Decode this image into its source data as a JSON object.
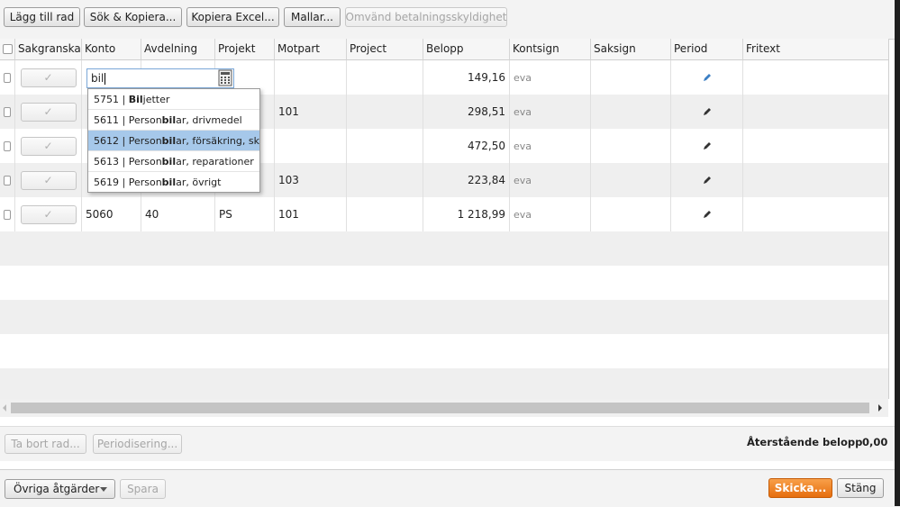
{
  "toolbar_top": {
    "buttons": [
      {
        "label": "Lägg till rad",
        "enabled": true
      },
      {
        "label": "Sök & Kopiera...",
        "enabled": true
      },
      {
        "label": "Kopiera Excel...",
        "enabled": true
      },
      {
        "label": "Mallar...",
        "enabled": true
      },
      {
        "label": "Omvänd betalningsskyldighet",
        "enabled": false
      }
    ]
  },
  "grid": {
    "columns": [
      "",
      "Sakgranska",
      "Konto",
      "Avdelning",
      "Projekt",
      "Motpart",
      "Project",
      "Belopp",
      "Kontsign",
      "Saksign",
      "Period",
      "Fritext"
    ],
    "rows": [
      {
        "konto": "",
        "avdelning": "",
        "projekt": "",
        "motpart": "",
        "project": "",
        "belopp": "149,16",
        "kontsign": "eva",
        "saksign": "",
        "period_icon": "pencil-icon",
        "fritext": ""
      },
      {
        "konto": "",
        "avdelning": "",
        "projekt": "",
        "motpart": "101",
        "project": "",
        "belopp": "298,51",
        "kontsign": "eva",
        "saksign": "",
        "period_icon": "pencil-icon",
        "fritext": ""
      },
      {
        "konto": "",
        "avdelning": "",
        "projekt": "",
        "motpart": "",
        "project": "",
        "belopp": "472,50",
        "kontsign": "eva",
        "saksign": "",
        "period_icon": "pencil-icon",
        "fritext": ""
      },
      {
        "konto": "",
        "avdelning": "",
        "projekt": "",
        "motpart": "103",
        "project": "",
        "belopp": "223,84",
        "kontsign": "eva",
        "saksign": "",
        "period_icon": "pencil-icon",
        "fritext": ""
      },
      {
        "konto": "5060",
        "avdelning": "40",
        "projekt": "PS",
        "motpart": "101",
        "project": "",
        "belopp": "1 218,99",
        "kontsign": "eva",
        "saksign": "",
        "period_icon": "pencil-icon",
        "fritext": ""
      }
    ],
    "sakgranska_mark": "✓"
  },
  "konto_editor": {
    "value": "bil",
    "suggestions": [
      {
        "code": "5751",
        "sep": " | ",
        "pre": "",
        "match": "Bil",
        "post": "jetter",
        "selected": false
      },
      {
        "code": "5611",
        "sep": " | ",
        "pre": "Person",
        "match": "bil",
        "post": "ar, drivmedel",
        "selected": false
      },
      {
        "code": "5612",
        "sep": " | ",
        "pre": "Person",
        "match": "bil",
        "post": "ar, försäkring, skatt",
        "selected": true
      },
      {
        "code": "5613",
        "sep": " | ",
        "pre": "Person",
        "match": "bil",
        "post": "ar, reparationer",
        "selected": false
      },
      {
        "code": "5619",
        "sep": " | ",
        "pre": "Person",
        "match": "bil",
        "post": "ar, övrigt",
        "selected": false
      }
    ]
  },
  "toolbar_mid": {
    "delete_label": "Ta bort rad...",
    "periodize_label": "Periodisering...",
    "remaining_label": "Återstående belopp",
    "remaining_value": "0,00"
  },
  "toolbar_bottom": {
    "other_actions_label": "Övriga åtgärder",
    "save_label": "Spara",
    "send_label": "Skicka...",
    "close_label": "Stäng"
  },
  "colors": {
    "accent_orange": "#f08a2a",
    "selection_blue": "#a6c8ea"
  }
}
